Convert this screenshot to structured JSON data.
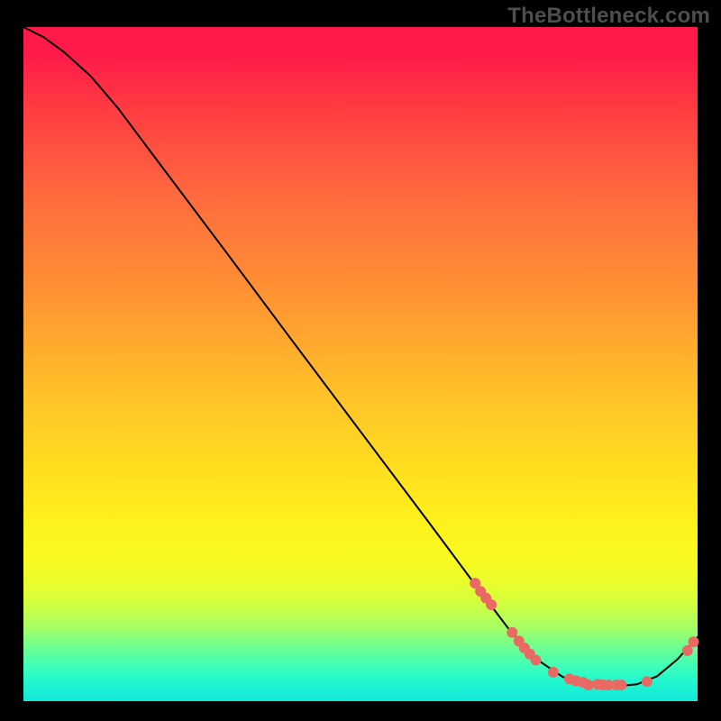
{
  "watermark": "TheBottleneck.com",
  "chart_data": {
    "type": "line",
    "title": "",
    "xlabel": "",
    "ylabel": "",
    "xlim": [
      0,
      100
    ],
    "ylim": [
      0,
      100
    ],
    "grid": false,
    "legend": false,
    "curve": [
      {
        "x": 0,
        "y": 100
      },
      {
        "x": 3,
        "y": 98.5
      },
      {
        "x": 6,
        "y": 96.3
      },
      {
        "x": 10,
        "y": 92.7
      },
      {
        "x": 14,
        "y": 88.0
      },
      {
        "x": 20,
        "y": 80.0
      },
      {
        "x": 30,
        "y": 66.7
      },
      {
        "x": 40,
        "y": 53.3
      },
      {
        "x": 50,
        "y": 40.0
      },
      {
        "x": 60,
        "y": 26.7
      },
      {
        "x": 67,
        "y": 17.3
      },
      {
        "x": 72,
        "y": 10.7
      },
      {
        "x": 76,
        "y": 6.3
      },
      {
        "x": 80,
        "y": 3.6
      },
      {
        "x": 84,
        "y": 2.4
      },
      {
        "x": 88,
        "y": 2.2
      },
      {
        "x": 91,
        "y": 2.5
      },
      {
        "x": 94,
        "y": 3.7
      },
      {
        "x": 97,
        "y": 6.2
      },
      {
        "x": 100,
        "y": 9.5
      }
    ],
    "markers": [
      {
        "x": 67.0,
        "y": 17.5
      },
      {
        "x": 67.8,
        "y": 16.3
      },
      {
        "x": 68.6,
        "y": 15.3
      },
      {
        "x": 69.4,
        "y": 14.3
      },
      {
        "x": 72.5,
        "y": 10.2
      },
      {
        "x": 73.5,
        "y": 8.9
      },
      {
        "x": 74.3,
        "y": 7.9
      },
      {
        "x": 75.1,
        "y": 7.0
      },
      {
        "x": 76.0,
        "y": 6.1
      },
      {
        "x": 78.6,
        "y": 4.3
      },
      {
        "x": 81.0,
        "y": 3.3
      },
      {
        "x": 82.0,
        "y": 3.0
      },
      {
        "x": 83.0,
        "y": 2.8
      },
      {
        "x": 83.8,
        "y": 2.4
      },
      {
        "x": 85.2,
        "y": 2.5
      },
      {
        "x": 86.0,
        "y": 2.4
      },
      {
        "x": 86.8,
        "y": 2.4
      },
      {
        "x": 88.0,
        "y": 2.4
      },
      {
        "x": 88.7,
        "y": 2.4
      },
      {
        "x": 92.5,
        "y": 2.9
      },
      {
        "x": 98.5,
        "y": 7.5
      },
      {
        "x": 99.4,
        "y": 8.8
      }
    ],
    "marker_style": {
      "color": "#e86a62",
      "radius_px": 6
    }
  }
}
